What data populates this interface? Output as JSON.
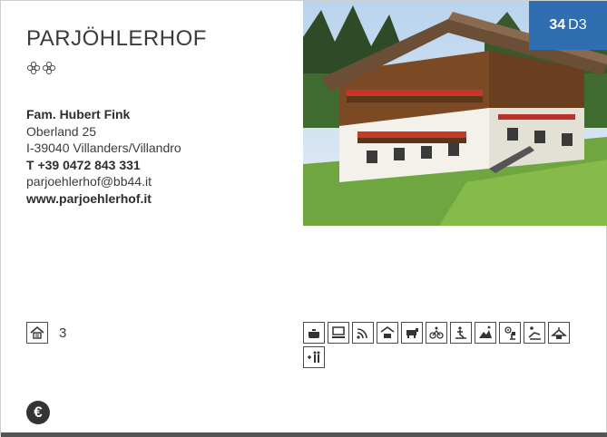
{
  "farm": {
    "name": "PARJÖHLERHOF",
    "rating_flowers": 2,
    "contact": {
      "owner": "Fam. Hubert Fink",
      "street": "Oberland 25",
      "city": "I-39040 Villanders/Villandro",
      "phone": "T +39 0472 843 331",
      "email": "parjoehlerhof@bb44.it",
      "website": "www.parjoehlerhof.it"
    }
  },
  "badge": {
    "number": "34",
    "grid": "D3",
    "color": "#2f6fb1"
  },
  "rooms": {
    "icon": "apartment-icon",
    "count": "3"
  },
  "amenities": [
    "cooking-pot-icon",
    "computer-icon",
    "wifi-icon",
    "garage-icon",
    "cow-icon",
    "bicycle-icon",
    "playground-icon",
    "hiking-icon",
    "flower-garden-icon",
    "sunbed-icon",
    "hanger-icon",
    "family-icon"
  ],
  "payment": {
    "icon": "euro-icon",
    "symbol": "€"
  }
}
